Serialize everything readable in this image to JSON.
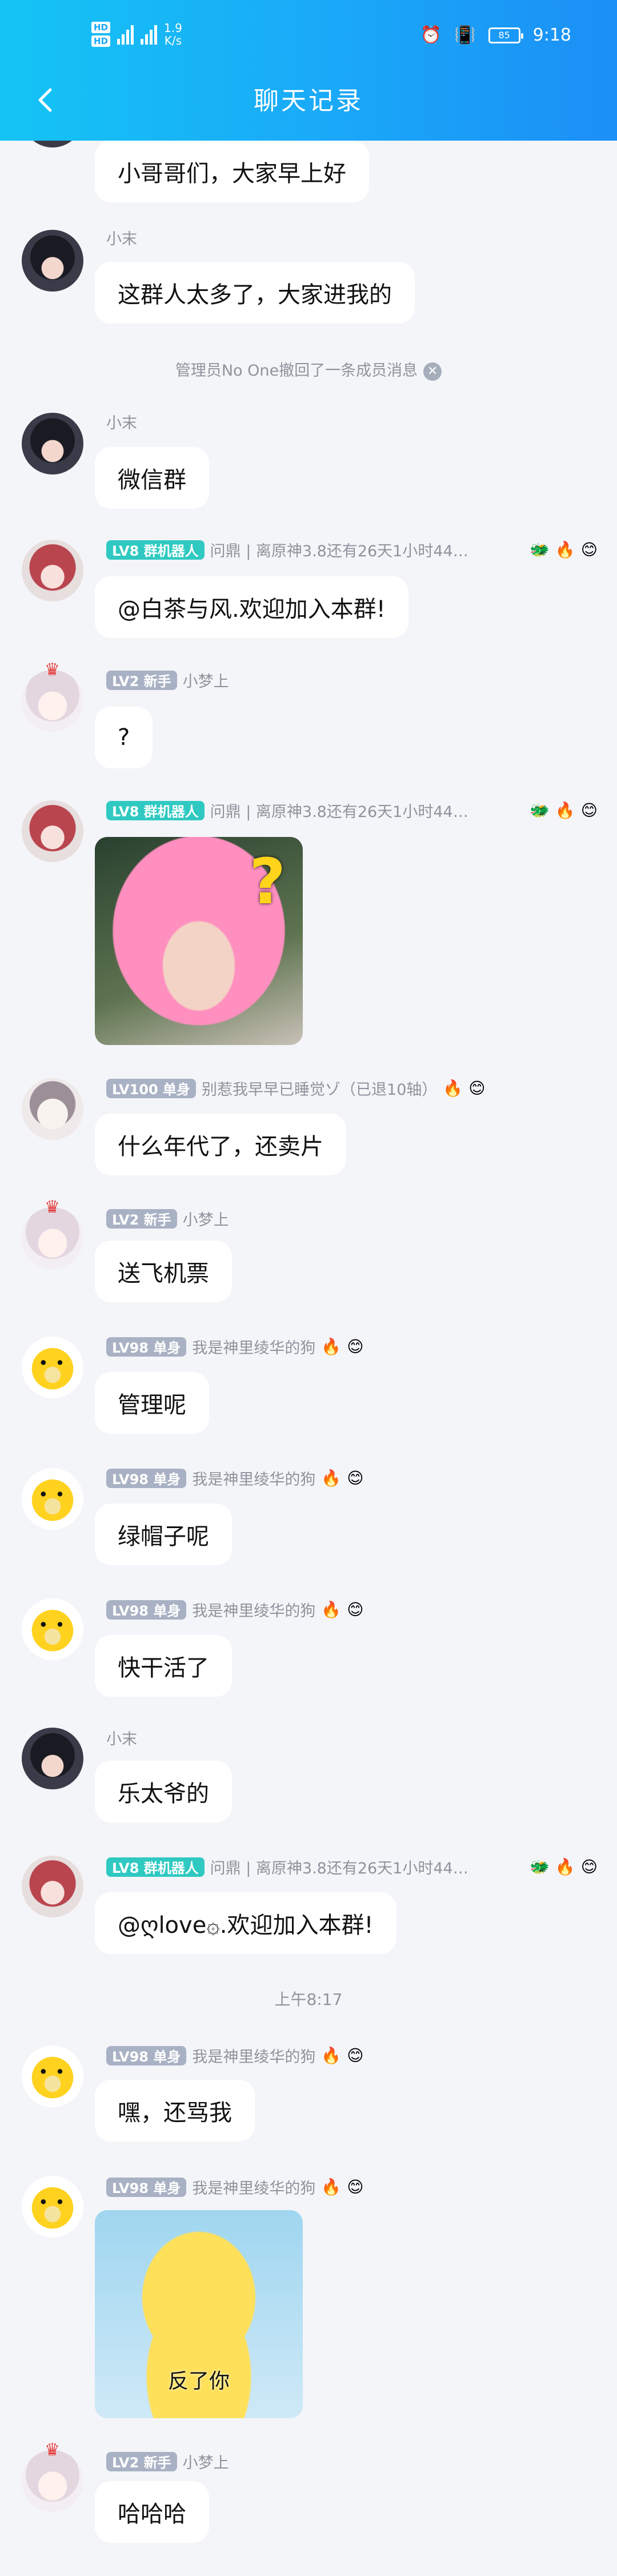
{
  "status_bar": {
    "hd1": "HD",
    "hd2": "HD",
    "speed_value": "1.9",
    "speed_unit": "K/s",
    "battery": "85",
    "time": "9:18"
  },
  "nav": {
    "title": "聊天记录"
  },
  "system_notice": "管理员No One撤回了一条成员消息",
  "time_separator": "上午8:17",
  "badges": {
    "owner": "LV8 群机器人",
    "lv2": "LV2 新手",
    "lv100": "LV100 单身",
    "lv98": "LV98 单身"
  },
  "nicks": {
    "xiaomo": "小末",
    "robot": "问鼎 | 离原神3.8还有26天1小时44…",
    "xiaomeng": "小梦上",
    "lv100": "别惹我早早已睡觉ゾ（已退10轴）",
    "duck": "我是神里绫华的狗"
  },
  "messages": {
    "m1": "小哥哥们，大家早上好",
    "m2": "这群人太多了，大家进我的",
    "m3": "微信群",
    "m4": "@白茶与风.欢迎加入本群!",
    "m5": "?",
    "m6": "什么年代了，还卖片",
    "m7": "送飞机票",
    "m8": "管理呢",
    "m9": "绿帽子呢",
    "m10": "快干活了",
    "m11": "乐太爷的",
    "m12": "@ღlove۞.欢迎加入本群!",
    "m13": "嘿，还骂我",
    "m14": "哈哈哈"
  },
  "sticker_caption": "反了你",
  "colors": {
    "header_start": "#14c4f4",
    "header_end": "#1b8ff6",
    "badge_teal": "#2fc9c1",
    "badge_gray": "#a9b1c4"
  }
}
